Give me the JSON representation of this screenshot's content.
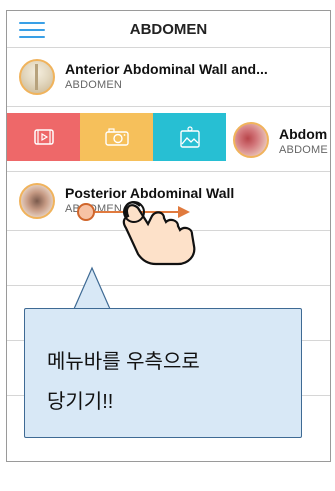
{
  "header": {
    "title": "ABDOMEN"
  },
  "items": [
    {
      "title": "Anterior  Abdominal Wall and...",
      "subtitle": "ABDOMEN"
    },
    {
      "title": "Abdom",
      "subtitle": "ABDOME"
    },
    {
      "title": "Posterior Abdominal Wall",
      "subtitle": "ABDOMEN"
    }
  ],
  "actions": {
    "video_icon": "video-icon",
    "camera_icon": "camera-icon",
    "gallery_icon": "gallery-icon",
    "colors": {
      "video": "#ee6869",
      "camera": "#f6c05b",
      "gallery": "#27bfd3"
    }
  },
  "callout": {
    "line1": "메뉴바를 우측으로",
    "line2": "당기기!!"
  },
  "colors": {
    "accent": "#3aa0e6",
    "thumb_border": "#f0b35c",
    "callout_bg": "#d8e8f6"
  }
}
